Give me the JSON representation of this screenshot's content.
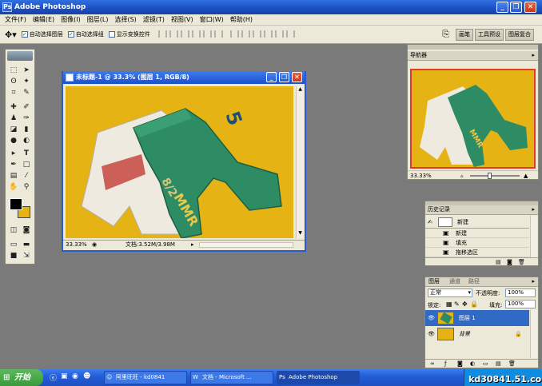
{
  "app": {
    "title": "Adobe Photoshop",
    "icon": "Ps"
  },
  "window_buttons": {
    "minimize": "_",
    "restore": "❐",
    "close": "✕"
  },
  "menu": [
    "文件(F)",
    "编辑(E)",
    "图像(I)",
    "图层(L)",
    "选择(S)",
    "滤镜(T)",
    "视图(V)",
    "窗口(W)",
    "帮助(H)"
  ],
  "options": {
    "auto_select_layer": "自动选择图层",
    "auto_select_group": "自动选择组",
    "show_transform": "显示变换控件",
    "palette_wells": [
      "画笔",
      "工具预设",
      "图层复合"
    ]
  },
  "document": {
    "title": "未标题-1 @ 33.3% (图层 1, RGB/8)",
    "zoom": "33.33%",
    "doc_size": "文档:3.52M/3.98M"
  },
  "navigator": {
    "title": "导航器",
    "zoom": "33.33%"
  },
  "history": {
    "title": "历史记录",
    "snapshot": "新建",
    "items": [
      "新建",
      "填充",
      "拖移选区"
    ]
  },
  "layers": {
    "tabs": [
      "图层",
      "通道",
      "路径"
    ],
    "blend_mode": "正常",
    "opacity_label": "不透明度:",
    "opacity": "100%",
    "lock_label": "锁定:",
    "fill_label": "填充:",
    "fill": "100%",
    "rows": [
      {
        "name": "图层 1",
        "selected": true
      },
      {
        "name": "背景",
        "selected": false
      }
    ]
  },
  "taskbar": {
    "start": "开始",
    "tasks": [
      "阿里旺旺 - kd0841",
      "文档 - Microsoft ...",
      "Adobe Photoshop"
    ],
    "watermark": "kd30841.51.com"
  },
  "colors": {
    "canvas_bg": "#e5b314",
    "pants": "#2e8c64",
    "title_bar": "#1a4fc4"
  }
}
